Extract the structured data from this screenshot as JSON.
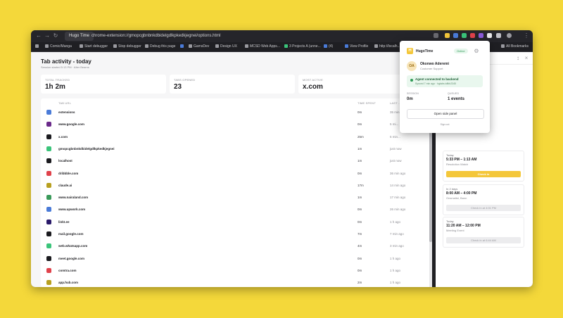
{
  "browser": {
    "tab_title": "Hugo Time",
    "url": "chrome-extension://gmopcgbnbnkdbidelgdlkpkedkjegnei/options.html",
    "all_bookmarks": "All Bookmarks"
  },
  "bookmarks": [
    "Comic/Manga",
    "Start debugger",
    "Stop debugger",
    "Debug this page",
    "",
    "GamsDev",
    "Design UX",
    "MCSD Web Apps...",
    "3 Projects A (unne...",
    "(4)",
    "View Profile",
    "http://localh..."
  ],
  "page": {
    "title": "Tab activity - today",
    "subtitle": "Session started 5:13 PM · Alter Beams",
    "cards": [
      {
        "label": "TOTAL TRACKED",
        "value": "1h 2m"
      },
      {
        "label": "TABS OPENED",
        "value": "23"
      },
      {
        "label": "MOST ACTIVE",
        "value": "x.com"
      }
    ],
    "columns": {
      "url": "TAB URL",
      "time": "TIME SPENT",
      "last": "LAST ..."
    }
  },
  "rows": [
    {
      "url": "extensions",
      "time": "0m",
      "last": "35 min...",
      "color": "#4a7bd8",
      "letter": "E"
    },
    {
      "url": "www.google.com",
      "time": "0m",
      "last": "5 mi...",
      "color": "#6a2a8a",
      "letter": "G"
    },
    {
      "url": "x.com",
      "time": "25m",
      "last": "5 min...",
      "color": "#1b1b1f",
      "letter": "X"
    },
    {
      "url": "gmopcgbnbnkdbidelgdlkpkedkjegnei",
      "time": "1m",
      "last": "just now",
      "color": "#3ac47a",
      "letter": "G"
    },
    {
      "url": "localhost",
      "time": "1m",
      "last": "just now",
      "color": "#1b1b1f",
      "letter": "L"
    },
    {
      "url": "dribbble.com",
      "time": "0m",
      "last": "36 min ago",
      "color": "#e0424b",
      "letter": "D"
    },
    {
      "url": "claude.ai",
      "time": "17m",
      "last": "14 min ago",
      "color": "#b8a020",
      "letter": "C"
    },
    {
      "url": "www.nairaland.com",
      "time": "1m",
      "last": "17 min ago",
      "color": "#3a9a5a",
      "letter": "N"
    },
    {
      "url": "www.upwork.com",
      "time": "0m",
      "last": "26 min ago",
      "color": "#4a7bd8",
      "letter": "U"
    },
    {
      "url": "linkt.ee",
      "time": "0m",
      "last": "1 h ago",
      "color": "#2a1a6a",
      "letter": "L"
    },
    {
      "url": "mail.google.com",
      "time": "7m",
      "last": "7 min ago",
      "color": "#1b1b1f",
      "letter": "M"
    },
    {
      "url": "web.whatsapp.com",
      "time": "4m",
      "last": "3 min ago",
      "color": "#3ac47a",
      "letter": "W"
    },
    {
      "url": "meet.google.com",
      "time": "0m",
      "last": "1 h ago",
      "color": "#1b1b1f",
      "letter": "M"
    },
    {
      "url": "comtra.com",
      "time": "0m",
      "last": "1 h ago",
      "color": "#e0424b",
      "letter": "C"
    },
    {
      "url": "app.hub.com",
      "time": "2m",
      "last": "1 h ago",
      "color": "#b8a020",
      "letter": "A"
    }
  ],
  "popup": {
    "app_name": "HugoTime",
    "online": "Online",
    "avatar": "OA",
    "user_name": "Okonwo Aderemi",
    "user_role": "Customer Support",
    "status_title": "Agent connected to backend",
    "status_sub": "Synced 7 min ago · hgtabs.tdfkh2345",
    "session_label": "SESSION",
    "session_value": "0m",
    "queued_label": "QUEUED",
    "queued_value": "1 events",
    "side_panel_button": "Open side panel",
    "sign_out": "Sign out"
  },
  "side_panel": {
    "events": [
      {
        "day": "Today",
        "time": "5:33 PM – 1:13 AM",
        "name": "Resolution Watch",
        "button": "Check in",
        "active": true
      },
      {
        "day": "In 2 days",
        "time": "8:00 AM – 4:00 PM",
        "name": "Onsmalist, Bann",
        "button": "Check in at 4:01 PM",
        "active": false
      },
      {
        "day": "Today",
        "time": "11:20 AM – 12:00 PM",
        "name": "Meeting Event",
        "button": "Check in at 6:44 AM",
        "active": false
      }
    ]
  }
}
